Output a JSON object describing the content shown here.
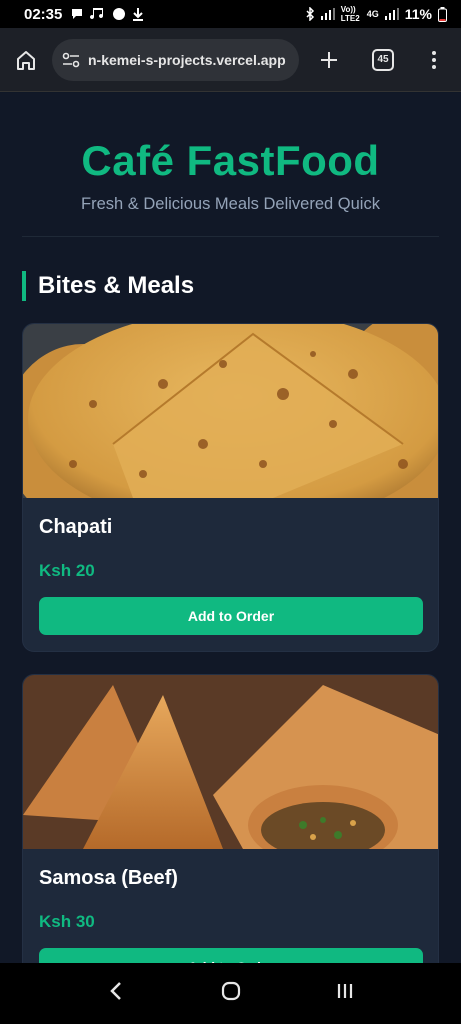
{
  "status": {
    "time": "02:35",
    "network": "Vo)) LTE2",
    "signal_label": "4G",
    "battery": "11%"
  },
  "browser": {
    "url": "n-kemei-s-projects.vercel.app",
    "tab_count": "45"
  },
  "header": {
    "title": "Café FastFood",
    "subtitle": "Fresh & Delicious Meals Delivered Quick"
  },
  "section": {
    "title": "Bites & Meals"
  },
  "items": [
    {
      "name": "Chapati",
      "price": "Ksh 20",
      "button": "Add to Order",
      "image": "chapati-photo"
    },
    {
      "name": "Samosa (Beef)",
      "price": "Ksh 30",
      "button": "Add to Order",
      "image": "samosa-photo"
    }
  ],
  "colors": {
    "accent": "#10b981",
    "background": "#111827",
    "card": "#1e293b"
  }
}
